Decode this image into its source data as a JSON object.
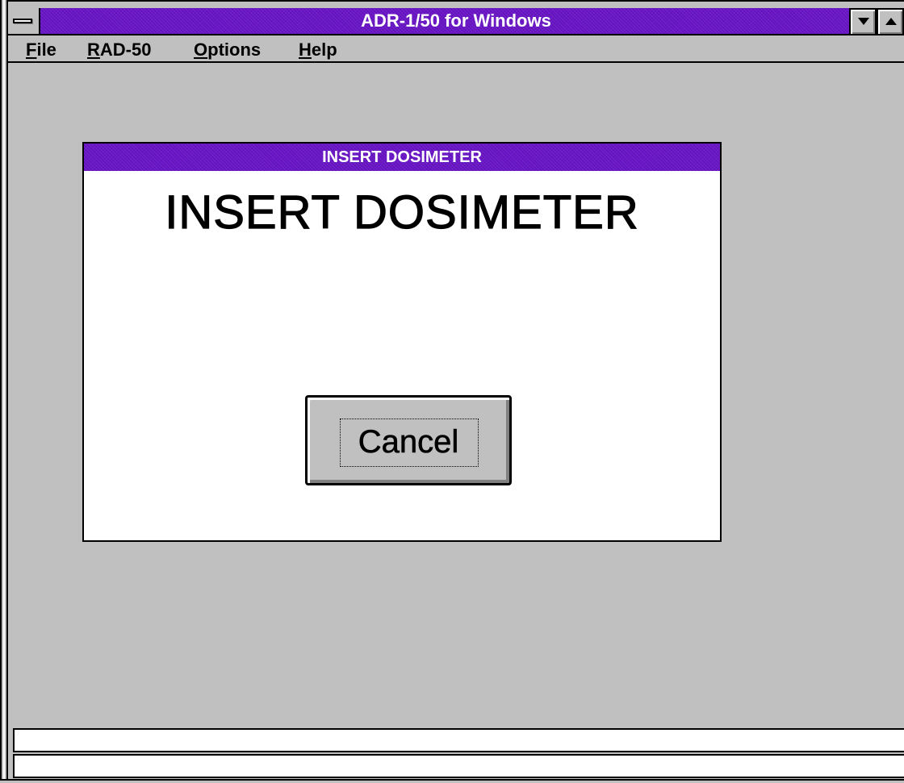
{
  "window": {
    "title": "ADR-1/50 for Windows"
  },
  "menu": {
    "items": [
      {
        "label": "File",
        "mnemonic": "F",
        "rest": "ile"
      },
      {
        "label": "RAD-50",
        "mnemonic": "R",
        "rest": "AD-50"
      },
      {
        "label": "Options",
        "mnemonic": "O",
        "rest": "ptions"
      },
      {
        "label": "Help",
        "mnemonic": "H",
        "rest": "elp"
      }
    ]
  },
  "dialog": {
    "title": "INSERT DOSIMETER",
    "message": "INSERT DOSIMETER",
    "cancel_label": "Cancel"
  },
  "status": {
    "line1": "",
    "line2": ""
  },
  "colors": {
    "titlebar": "#6a14c8",
    "face": "#c0c0c0",
    "dialog_bg": "#ffffff"
  }
}
